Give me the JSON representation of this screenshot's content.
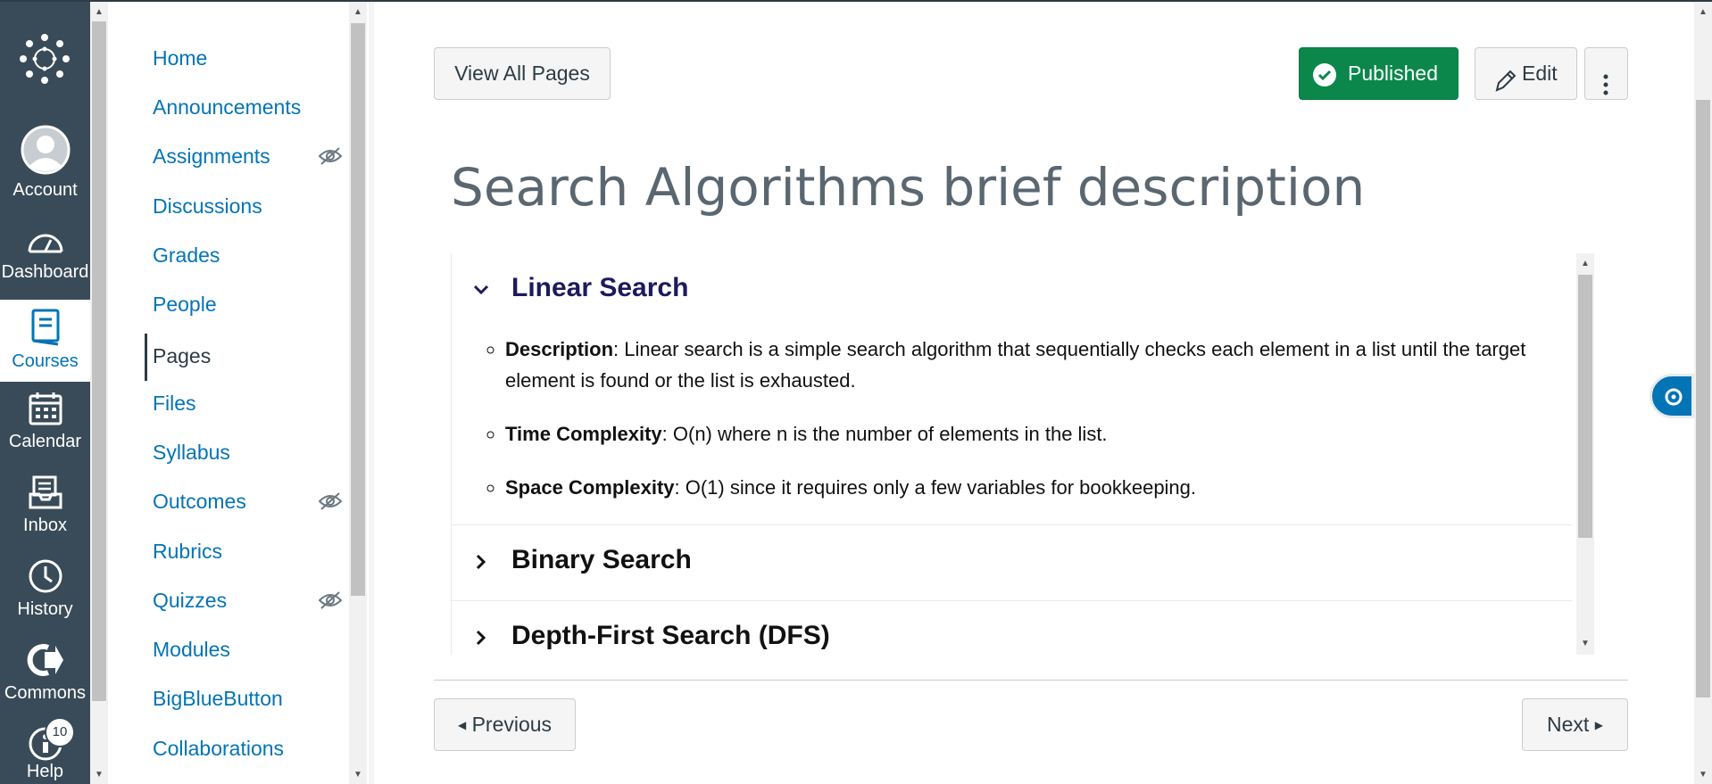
{
  "global_nav": {
    "items": [
      {
        "id": "account",
        "label": "Account",
        "icon": "account-avatar-icon"
      },
      {
        "id": "dashboard",
        "label": "Dashboard",
        "icon": "dashboard-gauge-icon"
      },
      {
        "id": "courses",
        "label": "Courses",
        "icon": "courses-book-icon",
        "active": true
      },
      {
        "id": "calendar",
        "label": "Calendar",
        "icon": "calendar-icon"
      },
      {
        "id": "inbox",
        "label": "Inbox",
        "icon": "inbox-icon"
      },
      {
        "id": "history",
        "label": "History",
        "icon": "history-clock-icon"
      },
      {
        "id": "commons",
        "label": "Commons",
        "icon": "commons-arrow-icon"
      },
      {
        "id": "help",
        "label": "Help",
        "icon": "help-icon",
        "badge": "10"
      }
    ]
  },
  "course_nav": {
    "items": [
      {
        "label": "Home"
      },
      {
        "label": "Announcements"
      },
      {
        "label": "Assignments",
        "hidden": true
      },
      {
        "label": "Discussions"
      },
      {
        "label": "Grades"
      },
      {
        "label": "People"
      },
      {
        "label": "Pages",
        "active": true
      },
      {
        "label": "Files"
      },
      {
        "label": "Syllabus"
      },
      {
        "label": "Outcomes",
        "hidden": true
      },
      {
        "label": "Rubrics"
      },
      {
        "label": "Quizzes",
        "hidden": true
      },
      {
        "label": "Modules"
      },
      {
        "label": "BigBlueButton"
      },
      {
        "label": "Collaborations"
      }
    ]
  },
  "toolbar": {
    "view_all_label": "View All Pages",
    "published_label": "Published",
    "edit_label": "Edit"
  },
  "page": {
    "title": "Search Algorithms brief description"
  },
  "accordion": [
    {
      "title": "Linear Search",
      "expanded": true,
      "items": [
        {
          "term": "Description",
          "text": ": Linear search is a simple search algorithm that sequentially checks each element in a list until the target element is found or the list is exhausted."
        },
        {
          "term": "Time Complexity",
          "text": ": O(n) where n is the number of elements in the list."
        },
        {
          "term": "Space Complexity",
          "text": ": O(1) since it requires only a few variables for bookkeeping."
        }
      ]
    },
    {
      "title": "Binary Search",
      "expanded": false
    },
    {
      "title": "Depth-First Search (DFS)",
      "expanded": false
    }
  ],
  "footer": {
    "previous_label": "Previous",
    "next_label": "Next"
  },
  "colors": {
    "global_nav_bg": "#394b58",
    "link_blue": "#0374b5",
    "published_green": "#0b874b",
    "expanded_title": "#1d1a5c"
  }
}
